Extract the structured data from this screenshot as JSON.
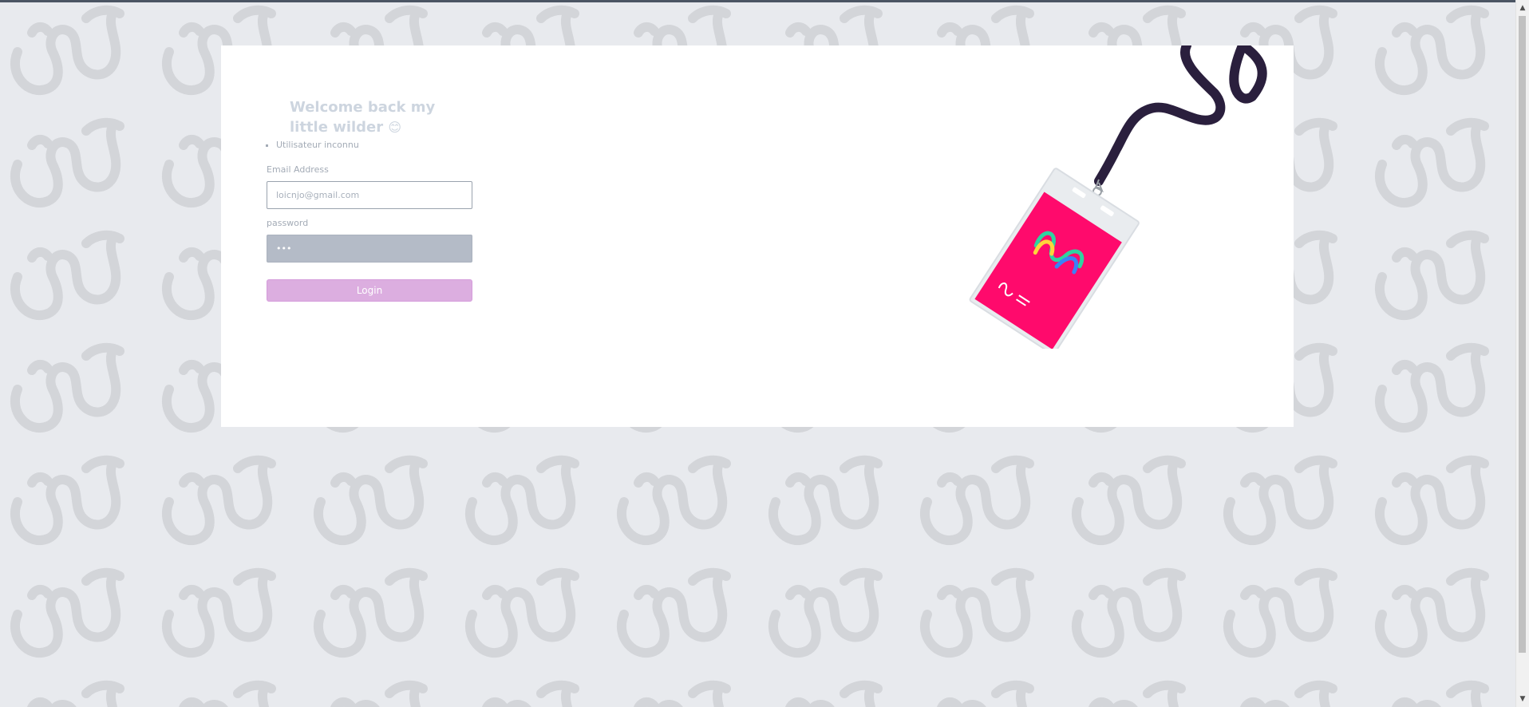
{
  "login": {
    "title": "Welcome back my little wilder",
    "title_emoji": "😊",
    "errors": [
      "Utilisateur inconnu"
    ],
    "email_label": "Email Address",
    "email_value": "loicnjo@gmail.com",
    "password_label": "password",
    "password_value": "•••",
    "login_label": "Login"
  },
  "badge": {
    "illustration": "lanyard-badge-icon"
  },
  "colors": {
    "background": "#e8eaee",
    "pattern": "#d3d5d9",
    "card": "#ffffff",
    "title": "#cdd5df",
    "button": "#dcaee0",
    "badge": "#ff0a6c",
    "lanyard": "#2a1f3d"
  }
}
